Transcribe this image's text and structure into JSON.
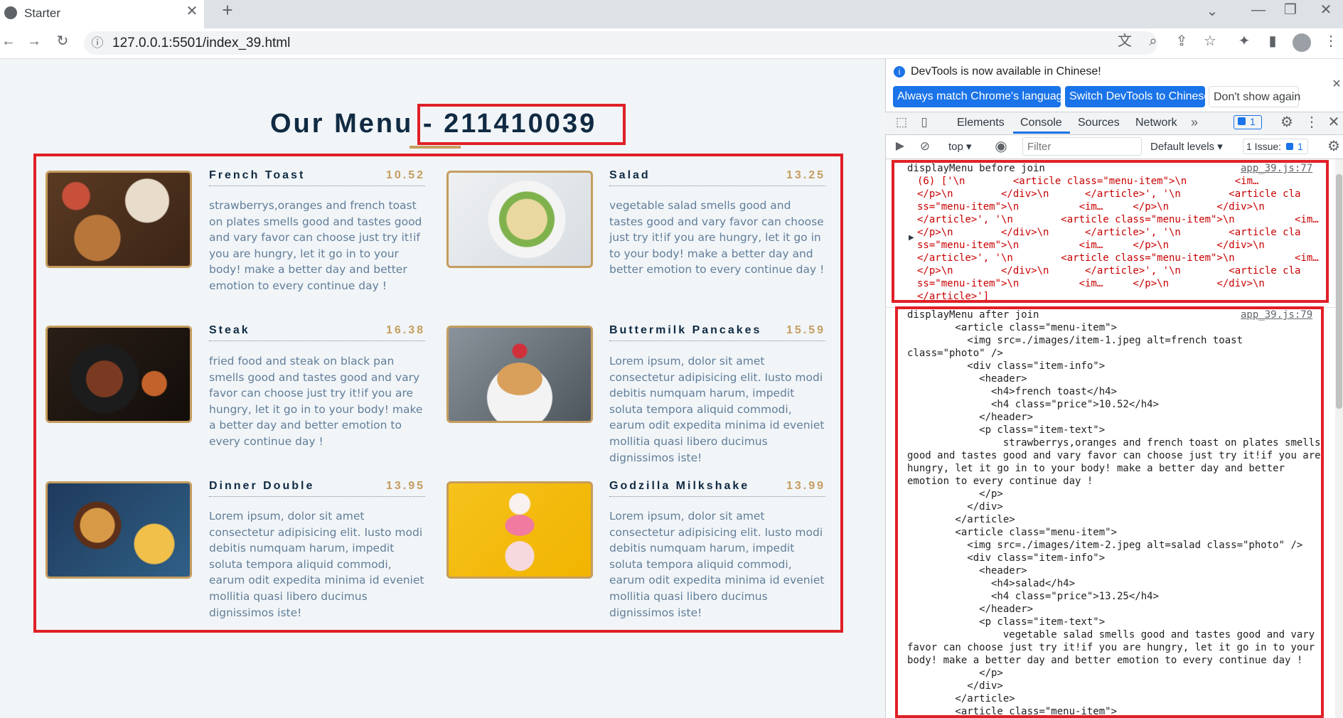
{
  "browser": {
    "tab_title": "Starter",
    "url": "127.0.0.1:5501/index_39.html"
  },
  "page": {
    "title": "Our Menu",
    "title_suffix": " - 211410039",
    "items": [
      {
        "name": "French Toast",
        "price": "10.52",
        "text": "strawberrys,oranges and french toast on plates smells good and tastes good and vary favor can choose just try it!if you are hungry, let it go in to your body! make a better day and better emotion to every continue day !"
      },
      {
        "name": "Salad",
        "price": "13.25",
        "text": "vegetable salad smells good and tastes good and vary favor can choose just try it!if you are hungry, let it go in to your body! make a better day and better emotion to every continue day !"
      },
      {
        "name": "Steak",
        "price": "16.38",
        "text": "fried food and steak on black pan smells good and tastes good and vary favor can choose just try it!if you are hungry, let it go in to your body! make a better day and better emotion to every continue day !"
      },
      {
        "name": "Buttermilk Pancakes",
        "price": "15.59",
        "text": "Lorem ipsum, dolor sit amet consectetur adipisicing elit. Iusto modi debitis numquam harum, impedit soluta tempora aliquid commodi, earum odit expedita minima id eveniet mollitia quasi libero ducimus dignissimos iste!"
      },
      {
        "name": "Dinner Double",
        "price": "13.95",
        "text": "Lorem ipsum, dolor sit amet consectetur adipisicing elit. Iusto modi debitis numquam harum, impedit soluta tempora aliquid commodi, earum odit expedita minima id eveniet mollitia quasi libero ducimus dignissimos iste!"
      },
      {
        "name": "Godzilla Milkshake",
        "price": "13.99",
        "text": "Lorem ipsum, dolor sit amet consectetur adipisicing elit. Iusto modi debitis numquam harum, impedit soluta tempora aliquid commodi, earum odit expedita minima id eveniet mollitia quasi libero ducimus dignissimos iste!"
      }
    ]
  },
  "devtools": {
    "notice": "DevTools is now available in Chinese!",
    "btn_match": "Always match Chrome's language",
    "btn_switch": "Switch DevTools to Chinese",
    "btn_dont_show": "Don't show again",
    "tabs": [
      "Elements",
      "Console",
      "Sources",
      "Network"
    ],
    "msg_badge": "1",
    "context": "top",
    "filter_placeholder": "Filter",
    "levels": "Default levels",
    "issues": "1 Issue:",
    "issues_count": "1",
    "log1_label": "displayMenu before join",
    "log1_source": "app_39.js:77",
    "log1_body": "(6) ['\\n        <article class=\"menu-item\">\\n        <im…\n</p>\\n        </div>\\n      </article>', '\\n        <article cla\nss=\"menu-item\">\\n          <im…     </p>\\n        </div>\\n\n</article>', '\\n        <article class=\"menu-item\">\\n          <im…\n</p>\\n        </div>\\n      </article>', '\\n        <article cla\nss=\"menu-item\">\\n          <im…     </p>\\n        </div>\\n\n</article>', '\\n        <article class=\"menu-item\">\\n          <im…\n</p>\\n        </div>\\n      </article>', '\\n        <article cla\nss=\"menu-item\">\\n          <im…     </p>\\n        </div>\\n\n</article>']",
    "log2_label": "displayMenu after join",
    "log2_source": "app_39.js:79",
    "log2_body": "        <article class=\"menu-item\">\n          <img src=./images/item-1.jpeg alt=french toast\nclass=\"photo\" />\n          <div class=\"item-info\">\n            <header>\n              <h4>french toast</h4>\n              <h4 class=\"price\">10.52</h4>\n            </header>\n            <p class=\"item-text\">\n                strawberrys,oranges and french toast on plates smells\ngood and tastes good and vary favor can choose just try it!if you are\nhungry, let it go in to your body! make a better day and better\nemotion to every continue day !\n            </p>\n          </div>\n        </article>\n        <article class=\"menu-item\">\n          <img src=./images/item-2.jpeg alt=salad class=\"photo\" />\n          <div class=\"item-info\">\n            <header>\n              <h4>salad</h4>\n              <h4 class=\"price\">13.25</h4>\n            </header>\n            <p class=\"item-text\">\n                vegetable salad smells good and tastes good and vary\nfavor can choose just try it!if you are hungry, let it go in to your\nbody! make a better day and better emotion to every continue day !\n            </p>\n          </div>\n        </article>\n        <article class=\"menu-item\">"
  }
}
